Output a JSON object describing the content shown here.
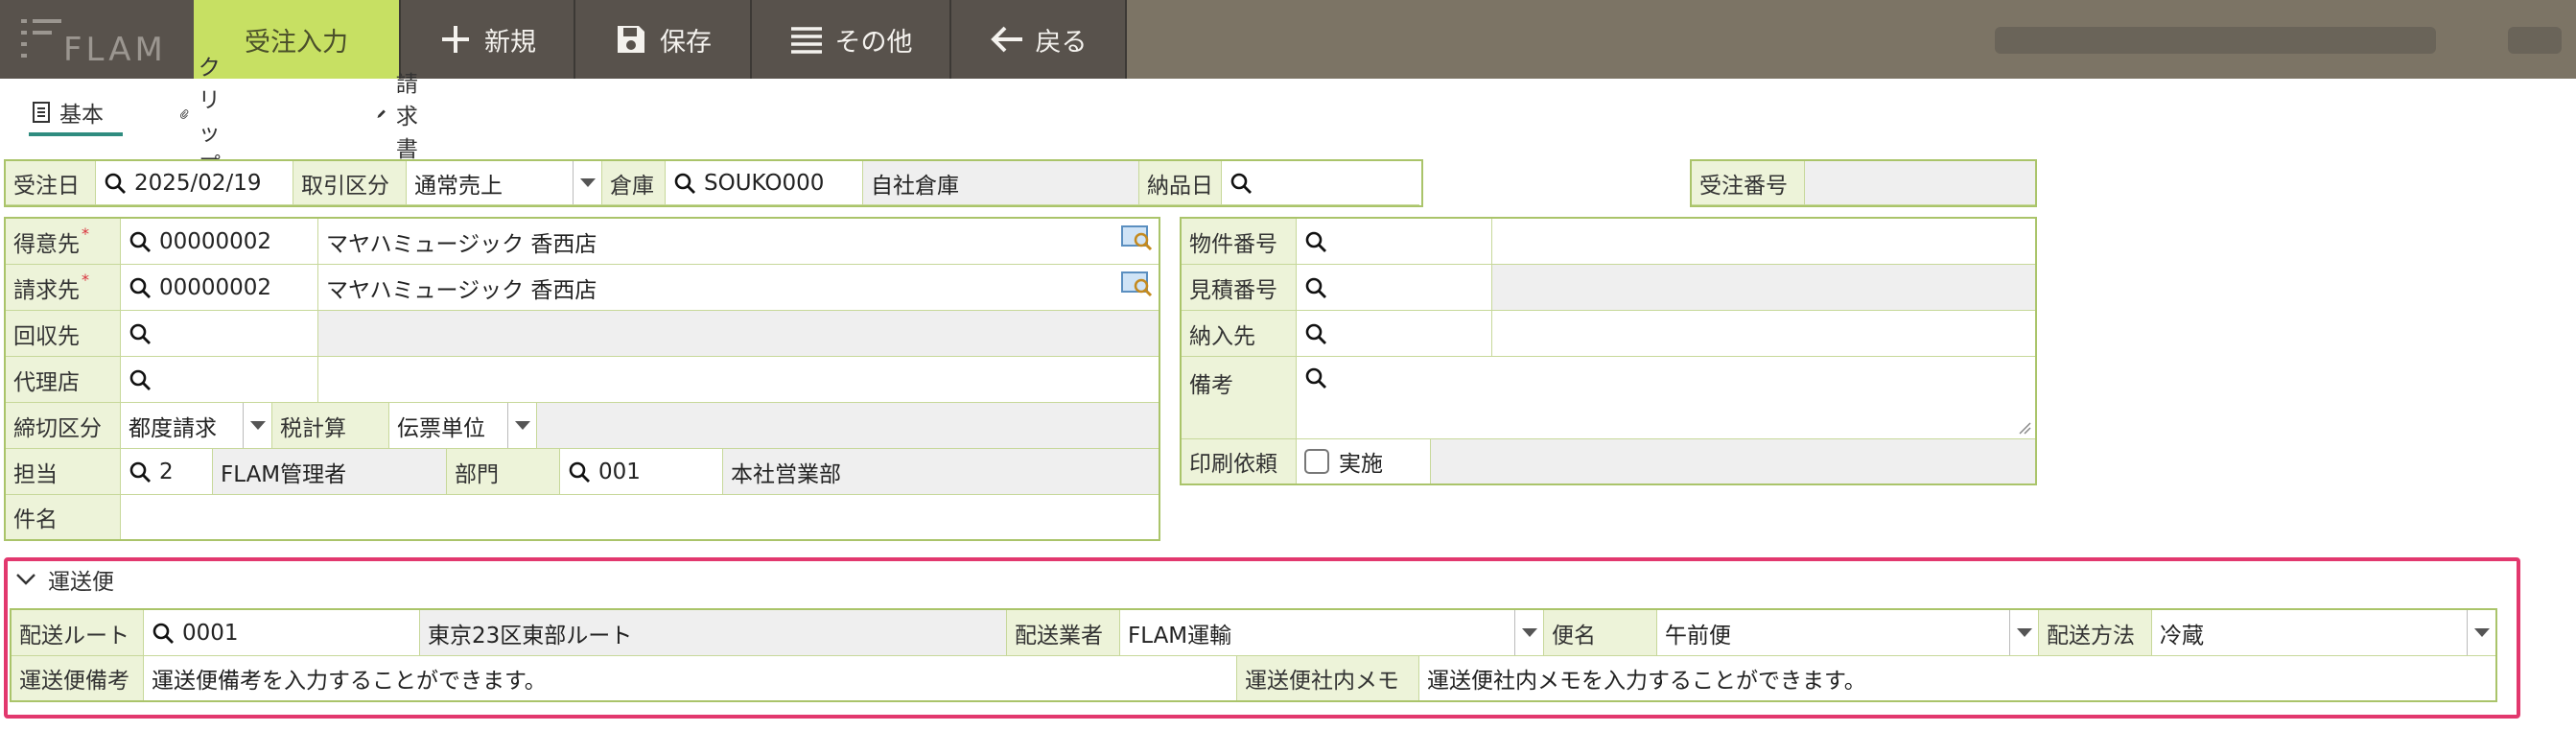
{
  "app": {
    "logo_text": "FLAM"
  },
  "toolbar": {
    "active_tab": "受注入力",
    "new_label": "新規",
    "save_label": "保存",
    "other_label": "その他",
    "back_label": "戻る"
  },
  "subtabs": {
    "basic": "基本",
    "clip": "クリップ",
    "invoice": "請求書"
  },
  "header_row": {
    "order_date_label": "受注日",
    "order_date": "2025/02/19",
    "trade_type_label": "取引区分",
    "trade_type": "通常売上",
    "warehouse_label": "倉庫",
    "warehouse_code": "SOUKO000",
    "warehouse_name": "自社倉庫",
    "delivery_date_label": "納品日",
    "delivery_date": "",
    "order_no_label": "受注番号",
    "order_no": ""
  },
  "left_form": {
    "customer_label": "得意先",
    "customer_code": "00000002",
    "customer_name": "マヤハミュージック 香西店",
    "billto_label": "請求先",
    "billto_code": "00000002",
    "billto_name": "マヤハミュージック 香西店",
    "collect_label": "回収先",
    "collect_code": "",
    "agent_label": "代理店",
    "agent_code": "",
    "closing_label": "締切区分",
    "closing": "都度請求",
    "tax_label": "税計算",
    "tax": "伝票単位",
    "staff_label": "担当",
    "staff_code": "2",
    "staff_name": "FLAM管理者",
    "dept_label": "部門",
    "dept_code": "001",
    "dept_name": "本社営業部",
    "subject_label": "件名",
    "subject": "",
    "required_mark": "*"
  },
  "right_form": {
    "property_label": "物件番号",
    "property_no": "",
    "estimate_label": "見積番号",
    "estimate_no": "",
    "deliver_to_label": "納入先",
    "deliver_to": "",
    "remarks_label": "備考",
    "remarks": "",
    "print_label": "印刷依頼",
    "print_checkbox_label": "実施",
    "print_checked": false
  },
  "shipping": {
    "section_title": "運送便",
    "route_label": "配送ルート",
    "route_code": "0001",
    "route_name": "東京23区東部ルート",
    "carrier_label": "配送業者",
    "carrier": "FLAM運輸",
    "flight_label": "便名",
    "flight": "午前便",
    "method_label": "配送方法",
    "method": "冷蔵",
    "note_label": "運送便備考",
    "note": "運送便備考を入力することができます。",
    "memo_label": "運送便社内メモ",
    "memo": "運送便社内メモを入力することができます。"
  },
  "colors": {
    "accent": "#c7e063",
    "topbar": "#58524c",
    "label_bg": "#edf3d9",
    "border": "#aac46a",
    "highlight": "#e2386e"
  }
}
